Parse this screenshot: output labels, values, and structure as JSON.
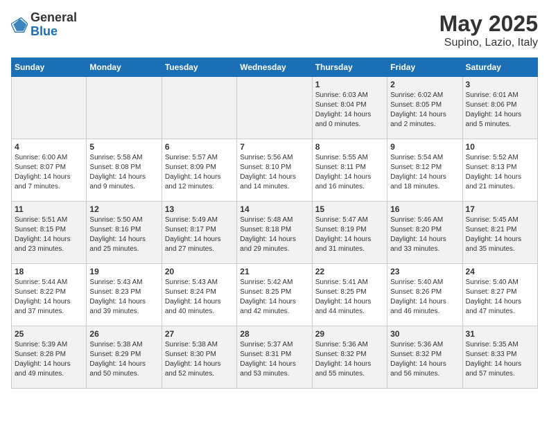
{
  "header": {
    "logo_general": "General",
    "logo_blue": "Blue",
    "title": "May 2025",
    "subtitle": "Supino, Lazio, Italy"
  },
  "weekdays": [
    "Sunday",
    "Monday",
    "Tuesday",
    "Wednesday",
    "Thursday",
    "Friday",
    "Saturday"
  ],
  "weeks": [
    [
      {
        "day": "",
        "info": ""
      },
      {
        "day": "",
        "info": ""
      },
      {
        "day": "",
        "info": ""
      },
      {
        "day": "",
        "info": ""
      },
      {
        "day": "1",
        "info": "Sunrise: 6:03 AM\nSunset: 8:04 PM\nDaylight: 14 hours and 0 minutes."
      },
      {
        "day": "2",
        "info": "Sunrise: 6:02 AM\nSunset: 8:05 PM\nDaylight: 14 hours and 2 minutes."
      },
      {
        "day": "3",
        "info": "Sunrise: 6:01 AM\nSunset: 8:06 PM\nDaylight: 14 hours and 5 minutes."
      }
    ],
    [
      {
        "day": "4",
        "info": "Sunrise: 6:00 AM\nSunset: 8:07 PM\nDaylight: 14 hours and 7 minutes."
      },
      {
        "day": "5",
        "info": "Sunrise: 5:58 AM\nSunset: 8:08 PM\nDaylight: 14 hours and 9 minutes."
      },
      {
        "day": "6",
        "info": "Sunrise: 5:57 AM\nSunset: 8:09 PM\nDaylight: 14 hours and 12 minutes."
      },
      {
        "day": "7",
        "info": "Sunrise: 5:56 AM\nSunset: 8:10 PM\nDaylight: 14 hours and 14 minutes."
      },
      {
        "day": "8",
        "info": "Sunrise: 5:55 AM\nSunset: 8:11 PM\nDaylight: 14 hours and 16 minutes."
      },
      {
        "day": "9",
        "info": "Sunrise: 5:54 AM\nSunset: 8:12 PM\nDaylight: 14 hours and 18 minutes."
      },
      {
        "day": "10",
        "info": "Sunrise: 5:52 AM\nSunset: 8:13 PM\nDaylight: 14 hours and 21 minutes."
      }
    ],
    [
      {
        "day": "11",
        "info": "Sunrise: 5:51 AM\nSunset: 8:15 PM\nDaylight: 14 hours and 23 minutes."
      },
      {
        "day": "12",
        "info": "Sunrise: 5:50 AM\nSunset: 8:16 PM\nDaylight: 14 hours and 25 minutes."
      },
      {
        "day": "13",
        "info": "Sunrise: 5:49 AM\nSunset: 8:17 PM\nDaylight: 14 hours and 27 minutes."
      },
      {
        "day": "14",
        "info": "Sunrise: 5:48 AM\nSunset: 8:18 PM\nDaylight: 14 hours and 29 minutes."
      },
      {
        "day": "15",
        "info": "Sunrise: 5:47 AM\nSunset: 8:19 PM\nDaylight: 14 hours and 31 minutes."
      },
      {
        "day": "16",
        "info": "Sunrise: 5:46 AM\nSunset: 8:20 PM\nDaylight: 14 hours and 33 minutes."
      },
      {
        "day": "17",
        "info": "Sunrise: 5:45 AM\nSunset: 8:21 PM\nDaylight: 14 hours and 35 minutes."
      }
    ],
    [
      {
        "day": "18",
        "info": "Sunrise: 5:44 AM\nSunset: 8:22 PM\nDaylight: 14 hours and 37 minutes."
      },
      {
        "day": "19",
        "info": "Sunrise: 5:43 AM\nSunset: 8:23 PM\nDaylight: 14 hours and 39 minutes."
      },
      {
        "day": "20",
        "info": "Sunrise: 5:43 AM\nSunset: 8:24 PM\nDaylight: 14 hours and 40 minutes."
      },
      {
        "day": "21",
        "info": "Sunrise: 5:42 AM\nSunset: 8:25 PM\nDaylight: 14 hours and 42 minutes."
      },
      {
        "day": "22",
        "info": "Sunrise: 5:41 AM\nSunset: 8:25 PM\nDaylight: 14 hours and 44 minutes."
      },
      {
        "day": "23",
        "info": "Sunrise: 5:40 AM\nSunset: 8:26 PM\nDaylight: 14 hours and 46 minutes."
      },
      {
        "day": "24",
        "info": "Sunrise: 5:40 AM\nSunset: 8:27 PM\nDaylight: 14 hours and 47 minutes."
      }
    ],
    [
      {
        "day": "25",
        "info": "Sunrise: 5:39 AM\nSunset: 8:28 PM\nDaylight: 14 hours and 49 minutes."
      },
      {
        "day": "26",
        "info": "Sunrise: 5:38 AM\nSunset: 8:29 PM\nDaylight: 14 hours and 50 minutes."
      },
      {
        "day": "27",
        "info": "Sunrise: 5:38 AM\nSunset: 8:30 PM\nDaylight: 14 hours and 52 minutes."
      },
      {
        "day": "28",
        "info": "Sunrise: 5:37 AM\nSunset: 8:31 PM\nDaylight: 14 hours and 53 minutes."
      },
      {
        "day": "29",
        "info": "Sunrise: 5:36 AM\nSunset: 8:32 PM\nDaylight: 14 hours and 55 minutes."
      },
      {
        "day": "30",
        "info": "Sunrise: 5:36 AM\nSunset: 8:32 PM\nDaylight: 14 hours and 56 minutes."
      },
      {
        "day": "31",
        "info": "Sunrise: 5:35 AM\nSunset: 8:33 PM\nDaylight: 14 hours and 57 minutes."
      }
    ]
  ]
}
